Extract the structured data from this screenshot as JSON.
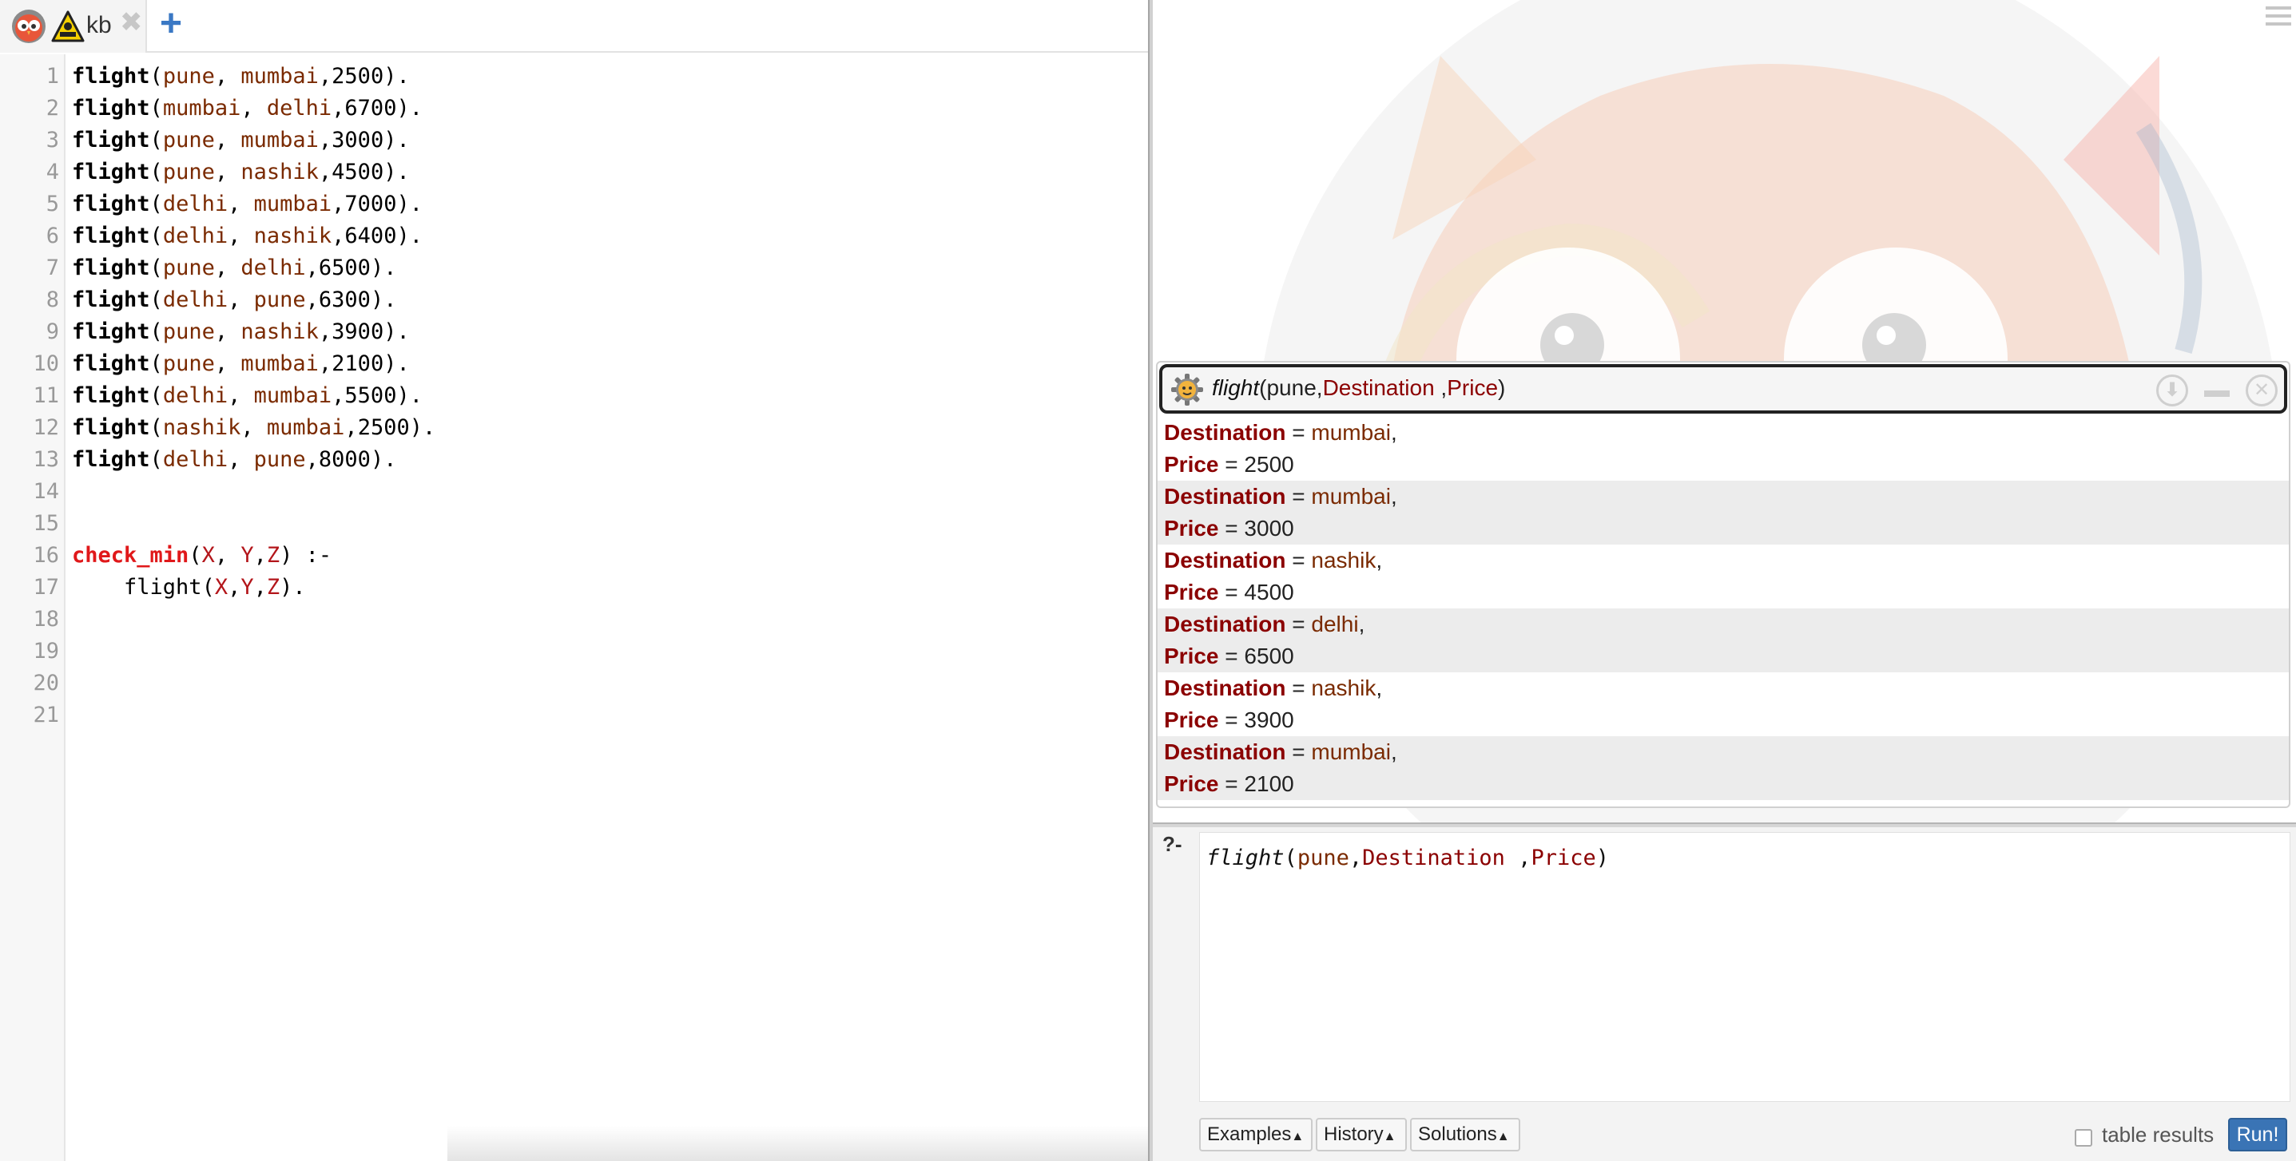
{
  "tab": {
    "label": "kb",
    "close": "✖",
    "new": "+"
  },
  "editor": {
    "line_numbers": [
      "1",
      "2",
      "3",
      "4",
      "5",
      "6",
      "7",
      "8",
      "9",
      "10",
      "11",
      "12",
      "13",
      "14",
      "15",
      "16",
      "17",
      "18",
      "19",
      "20",
      "21"
    ]
  },
  "facts": [
    {
      "name": "flight",
      "a": "pune",
      "b": "mumbai",
      "price": "2500"
    },
    {
      "name": "flight",
      "a": "mumbai",
      "b": "delhi",
      "price": "6700"
    },
    {
      "name": "flight",
      "a": "pune",
      "b": "mumbai",
      "price": "3000"
    },
    {
      "name": "flight",
      "a": "pune",
      "b": "nashik",
      "price": "4500"
    },
    {
      "name": "flight",
      "a": "delhi",
      "b": "mumbai",
      "price": "7000"
    },
    {
      "name": "flight",
      "a": "delhi",
      "b": "nashik",
      "price": "6400"
    },
    {
      "name": "flight",
      "a": "pune",
      "b": "delhi",
      "price": "6500"
    },
    {
      "name": "flight",
      "a": "delhi",
      "b": "pune",
      "price": "6300"
    },
    {
      "name": "flight",
      "a": "pune",
      "b": "nashik",
      "price": "3900"
    },
    {
      "name": "flight",
      "a": "pune",
      "b": "mumbai",
      "price": "2100"
    },
    {
      "name": "flight",
      "a": "delhi",
      "b": "mumbai",
      "price": "5500"
    },
    {
      "name": "flight",
      "a": "nashik",
      "b": "mumbai",
      "price": "2500"
    },
    {
      "name": "flight",
      "a": "delhi",
      "b": "pune",
      "price": "8000"
    }
  ],
  "rule": {
    "head": "check_min",
    "head_vars": [
      "X",
      "Y",
      "Z"
    ],
    "neck": ":-",
    "body_pred": "flight",
    "body_vars": [
      "X",
      "Y",
      "Z"
    ]
  },
  "answer_panel": {
    "header_pred": "flight",
    "header_arg1": "pune",
    "header_var1": "Destination",
    "header_var2": "Price",
    "answers": [
      {
        "dest": "mumbai",
        "price": "2500"
      },
      {
        "dest": "mumbai",
        "price": "3000"
      },
      {
        "dest": "nashik",
        "price": "4500"
      },
      {
        "dest": "delhi",
        "price": "6500"
      },
      {
        "dest": "nashik",
        "price": "3900"
      },
      {
        "dest": "mumbai",
        "price": "2100"
      }
    ],
    "var_dest_label": "Destination",
    "var_price_label": "Price"
  },
  "query": {
    "prompt": "?-",
    "pred": "flight",
    "arg1": "pune",
    "var1": "Destination",
    "var2": "Price"
  },
  "buttons": {
    "examples": "Examples",
    "history": "History",
    "solutions": "Solutions",
    "table_results": "table results",
    "run": "Run!"
  }
}
